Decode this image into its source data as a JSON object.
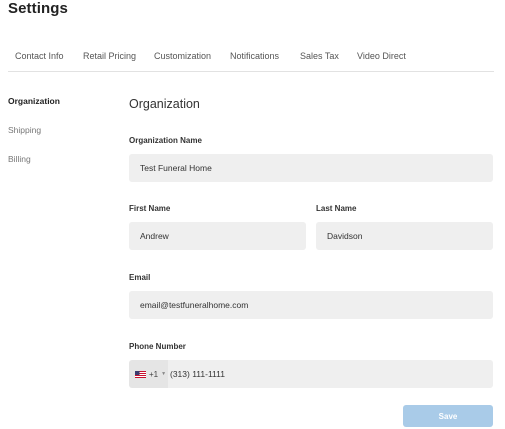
{
  "page": {
    "title": "Settings"
  },
  "tabs": [
    {
      "label": "Contact Info"
    },
    {
      "label": "Retail Pricing"
    },
    {
      "label": "Customization"
    },
    {
      "label": "Notifications"
    },
    {
      "label": "Sales Tax"
    },
    {
      "label": "Video Direct"
    }
  ],
  "sidebar": {
    "items": [
      {
        "label": "Organization",
        "active": true
      },
      {
        "label": "Shipping",
        "active": false
      },
      {
        "label": "Billing",
        "active": false
      }
    ]
  },
  "form": {
    "section_title": "Organization",
    "organization_name": {
      "label": "Organization Name",
      "value": "Test Funeral Home"
    },
    "first_name": {
      "label": "First Name",
      "value": "Andrew"
    },
    "last_name": {
      "label": "Last Name",
      "value": "Davidson"
    },
    "email": {
      "label": "Email",
      "value": "email@testfuneralhome.com"
    },
    "phone": {
      "label": "Phone Number",
      "country_flag": "us-flag-icon",
      "dial_code": "+1",
      "value": "(313) 111-1111"
    },
    "save_label": "Save"
  },
  "colors": {
    "accent_disabled": "#a9cbe8",
    "field_bg": "#efefef"
  }
}
